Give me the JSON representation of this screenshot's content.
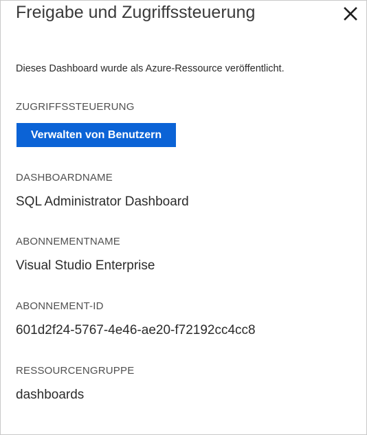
{
  "header": {
    "title": "Freigabe und Zugriffssteuerung",
    "close_icon": "close-icon"
  },
  "intro": "Dieses Dashboard wurde als Azure-Ressource veröffentlicht.",
  "access": {
    "label": "ZUGRIFFSSTEUERUNG",
    "manage_users_button": "Verwalten von Benutzern"
  },
  "fields": {
    "dashboard_name_label": "DASHBOARDNAME",
    "dashboard_name_value": "SQL Administrator Dashboard",
    "subscription_name_label": "ABONNEMENTNAME",
    "subscription_name_value": "Visual Studio Enterprise",
    "subscription_id_label": "ABONNEMENT-ID",
    "subscription_id_value": "601d2f24-5767-4e46-ae20-f72192cc4cc8",
    "resource_group_label": "RESSOURCENGRUPPE",
    "resource_group_value": "dashboards"
  },
  "colors": {
    "accent": "#0b63d6",
    "border": "#c8c8c8"
  }
}
